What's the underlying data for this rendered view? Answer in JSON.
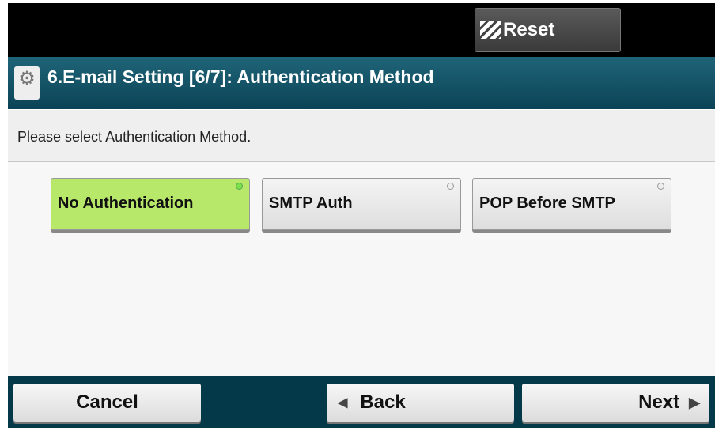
{
  "topbar": {
    "reset_label": "Reset"
  },
  "header": {
    "title": "6.E-mail Setting [6/7]: Authentication Method"
  },
  "instruction": "Please select Authentication Method.",
  "options": [
    {
      "label": "No Authentication",
      "selected": true
    },
    {
      "label": "SMTP Auth",
      "selected": false
    },
    {
      "label": "POP Before SMTP",
      "selected": false
    }
  ],
  "footer": {
    "cancel": "Cancel",
    "back": "Back",
    "next": "Next",
    "back_arrow": "◀",
    "next_arrow": "▶"
  },
  "colors": {
    "selected": "#b8e86a",
    "header": "#0c4356",
    "footer": "#04394a"
  }
}
